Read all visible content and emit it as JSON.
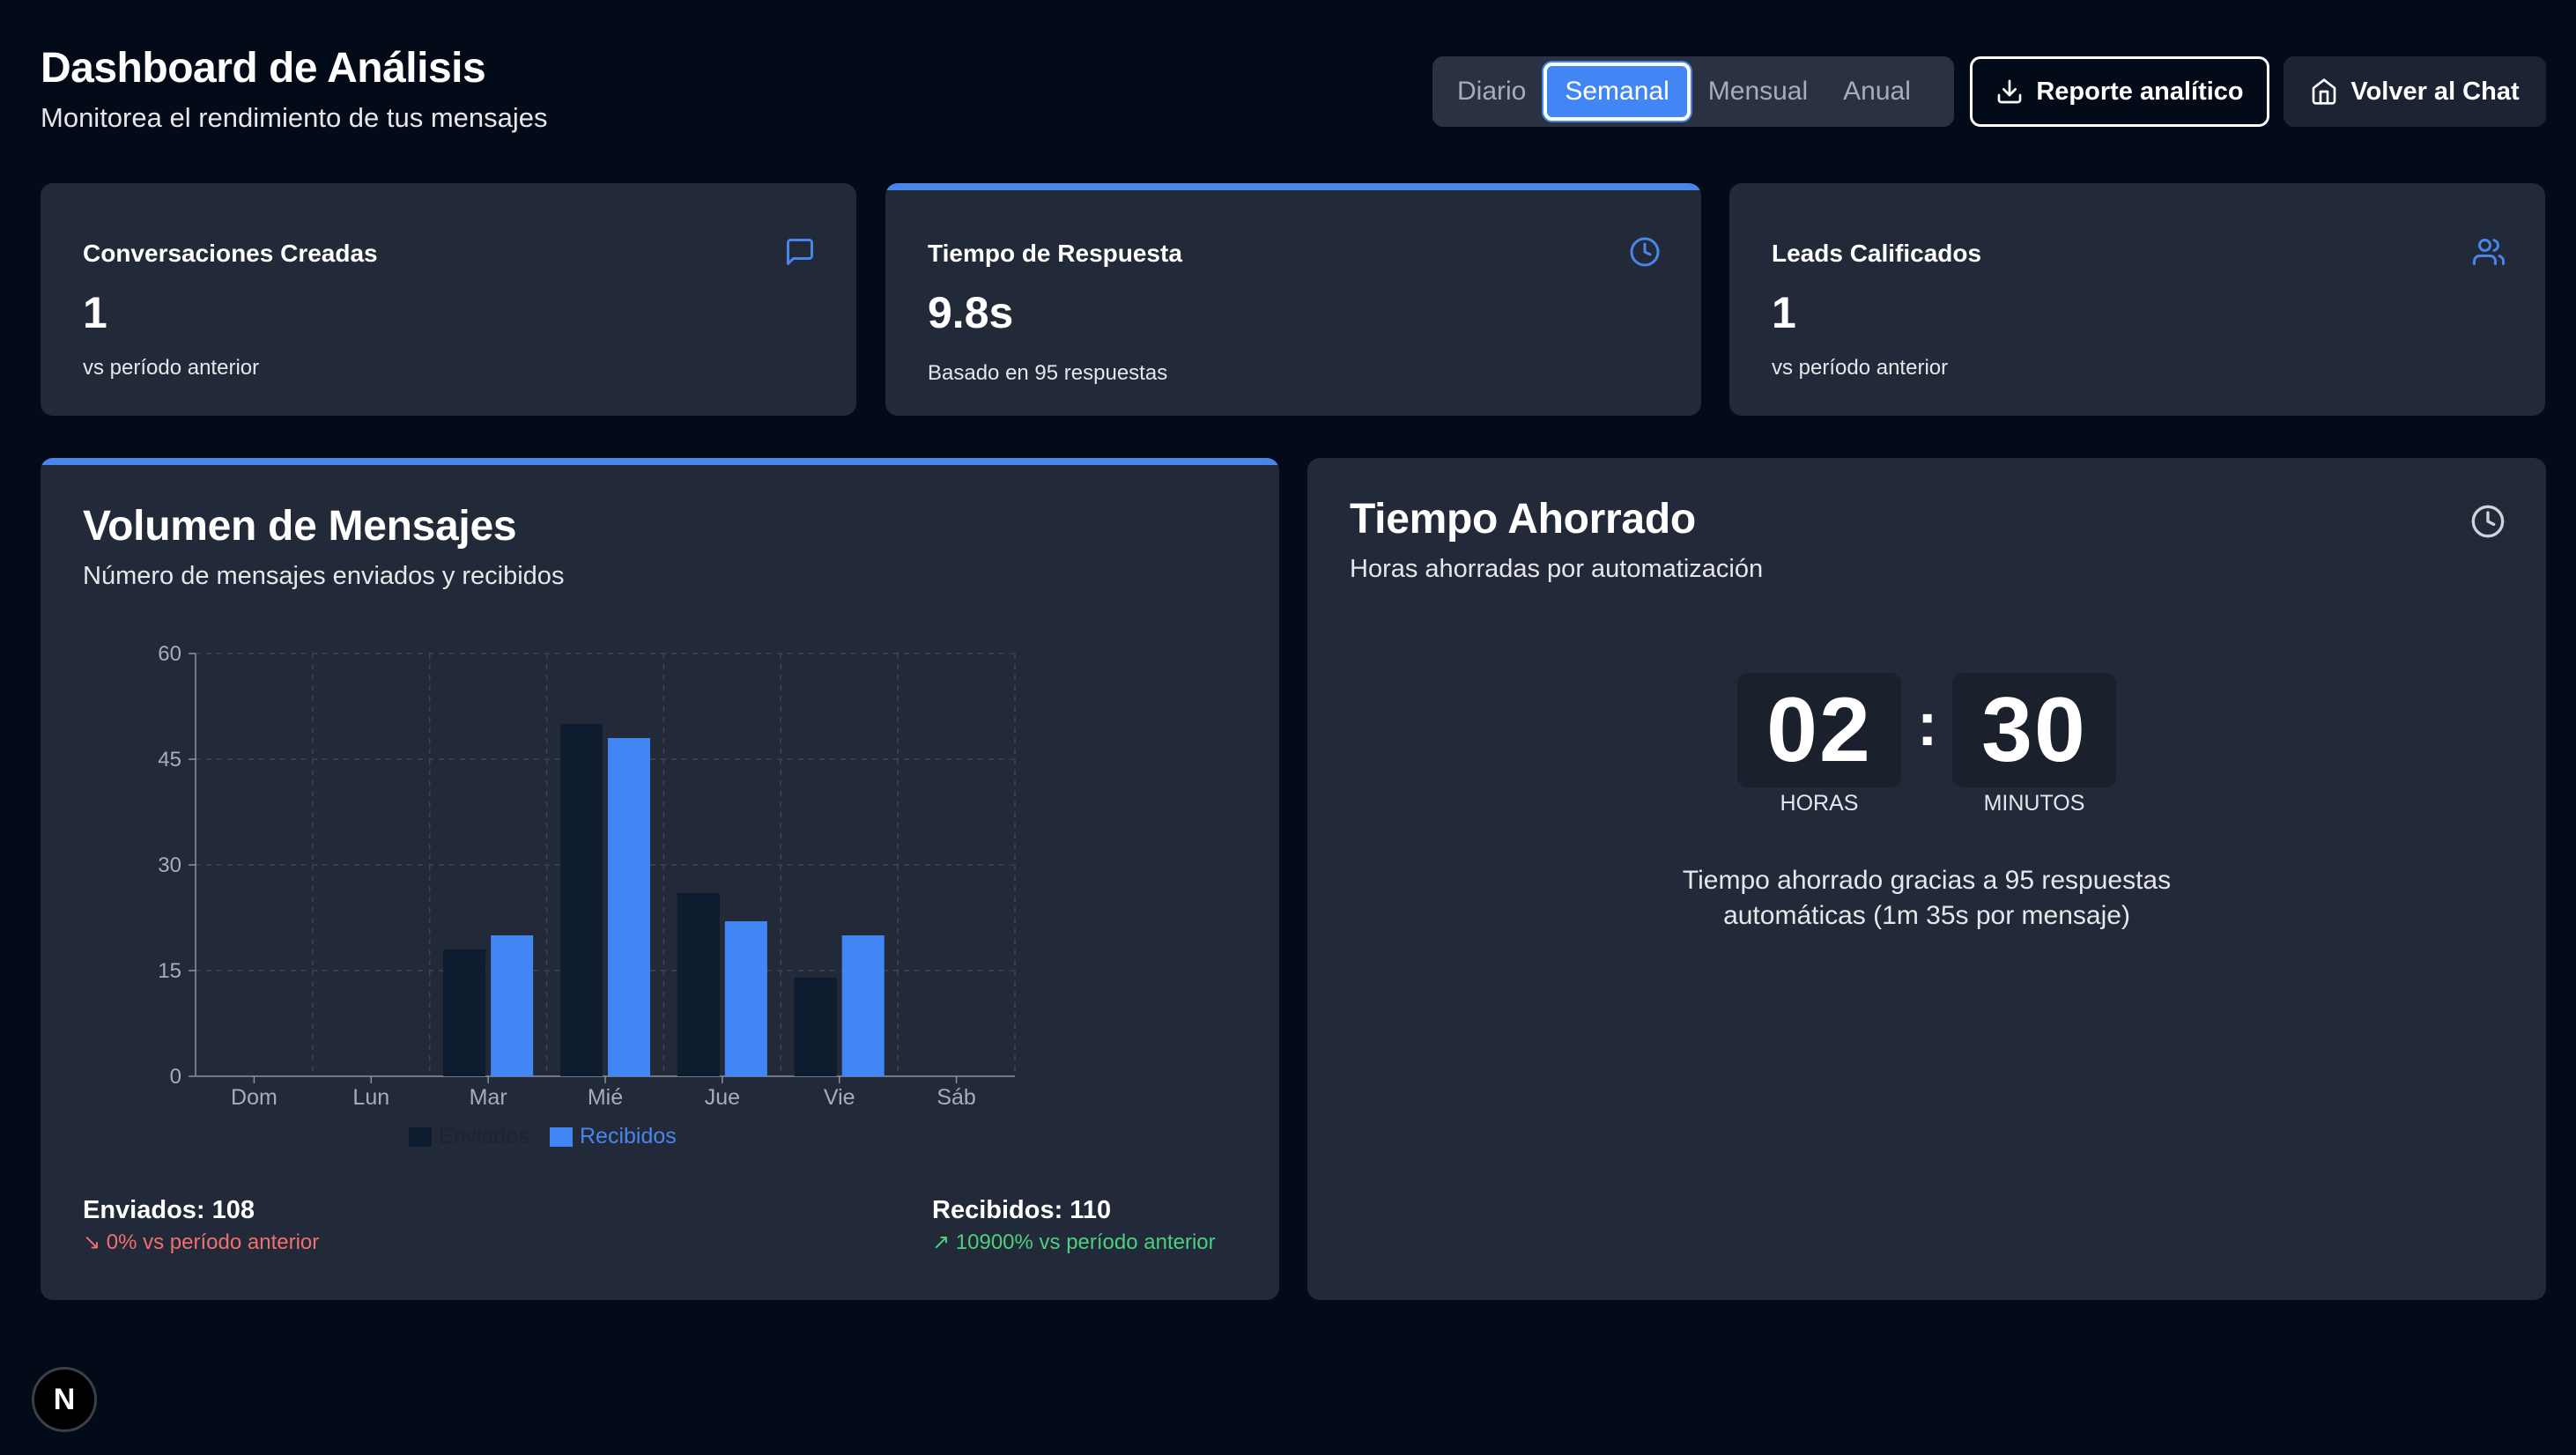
{
  "header": {
    "title": "Dashboard de Análisis",
    "subtitle": "Monitorea el rendimiento de tus mensajes"
  },
  "periods": [
    "Diario",
    "Semanal",
    "Mensual",
    "Anual"
  ],
  "active_period": "Semanal",
  "buttons": {
    "report": "Reporte analítico",
    "chat": "Volver al Chat"
  },
  "stats": [
    {
      "label": "Conversaciones Creadas",
      "value": "1",
      "note": "vs período anterior",
      "icon": "message-square-icon"
    },
    {
      "label": "Tiempo de Respuesta",
      "value": "9.8s",
      "note": "Basado en 95 respuestas",
      "icon": "clock-icon"
    },
    {
      "label": "Leads Calificados",
      "value": "1",
      "note": "vs período anterior",
      "icon": "users-icon"
    }
  ],
  "volume": {
    "title": "Volumen de Mensajes",
    "subtitle": "Número de mensajes enviados y recibidos",
    "sent_summary": "Enviados: 108",
    "sent_change": "↘ 0% vs período anterior",
    "received_summary": "Recibidos: 110",
    "received_change": "↗ 10900% vs período anterior"
  },
  "chart_data": {
    "type": "bar",
    "categories": [
      "Dom",
      "Lun",
      "Mar",
      "Mié",
      "Jue",
      "Vie",
      "Sáb"
    ],
    "series": [
      {
        "name": "Enviados",
        "values": [
          0,
          0,
          18,
          50,
          26,
          14,
          0
        ],
        "color": "#0f1b2e"
      },
      {
        "name": "Recibidos",
        "values": [
          0,
          0,
          20,
          48,
          22,
          20,
          0
        ],
        "color": "#4285f4"
      }
    ],
    "yticks": [
      0,
      15,
      30,
      45,
      60
    ],
    "ylim": [
      0,
      60
    ],
    "grid": true,
    "legend": "bottom"
  },
  "time_saved": {
    "title": "Tiempo Ahorrado",
    "subtitle": "Horas ahorradas por automatización",
    "hours": "02",
    "minutes": "30",
    "hours_label": "HORAS",
    "minutes_label": "MINUTOS",
    "description_line1": "Tiempo ahorrado gracias a 95 respuestas",
    "description_line2": "automáticas (1m 35s por mensaje)"
  },
  "badge": "N",
  "colors": {
    "background": "#030a18",
    "card": "#222938",
    "accent": "#4285f4",
    "negative": "#f06f6f",
    "positive": "#4ccf7e"
  }
}
